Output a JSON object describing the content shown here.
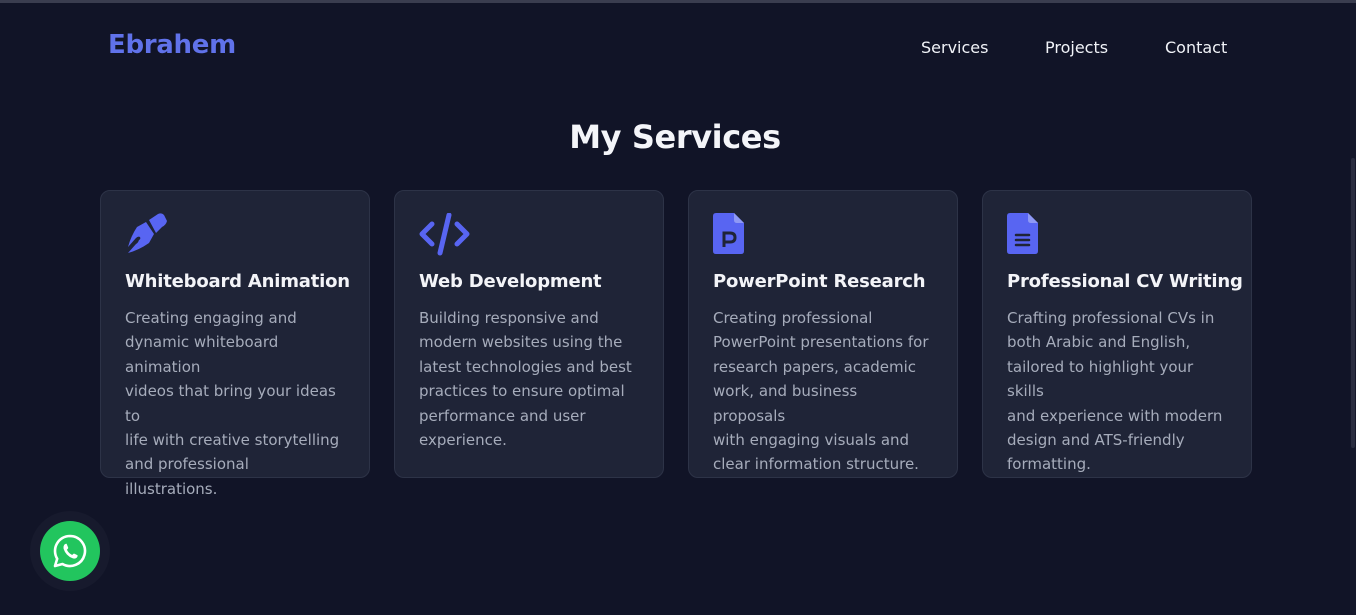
{
  "header": {
    "logo": "Ebrahem",
    "nav": [
      "Services",
      "Projects",
      "Contact"
    ]
  },
  "services": {
    "title": "My Services",
    "cards": [
      {
        "icon": "pen-nib-icon",
        "title": "Whiteboard Animation",
        "lines": [
          "Creating engaging and",
          "dynamic whiteboard animation",
          "videos that bring your ideas to",
          "life with creative storytelling",
          "and professional illustrations."
        ]
      },
      {
        "icon": "code-icon",
        "title": "Web Development",
        "lines": [
          "Building responsive and",
          "modern websites using the",
          "latest technologies and best",
          "practices to ensure optimal",
          "performance and user",
          "experience."
        ]
      },
      {
        "icon": "powerpoint-file-icon",
        "title": "PowerPoint Research",
        "lines": [
          "Creating professional",
          "PowerPoint presentations for",
          "research papers, academic",
          "work, and business proposals",
          "with engaging visuals and",
          "clear information structure."
        ]
      },
      {
        "icon": "document-icon",
        "title": "Professional CV Writing",
        "lines": [
          "Crafting professional CVs in",
          "both Arabic and English,",
          "tailored to highlight your skills",
          "and experience with modern",
          "design and ATS-friendly",
          "formatting."
        ]
      }
    ]
  },
  "whatsapp": {
    "icon": "whatsapp-icon"
  },
  "colors": {
    "background": "#111427",
    "card": "#1f2437",
    "accent": "#6072ea",
    "icon": "#5865f2",
    "whatsapp": "#22c55e"
  }
}
